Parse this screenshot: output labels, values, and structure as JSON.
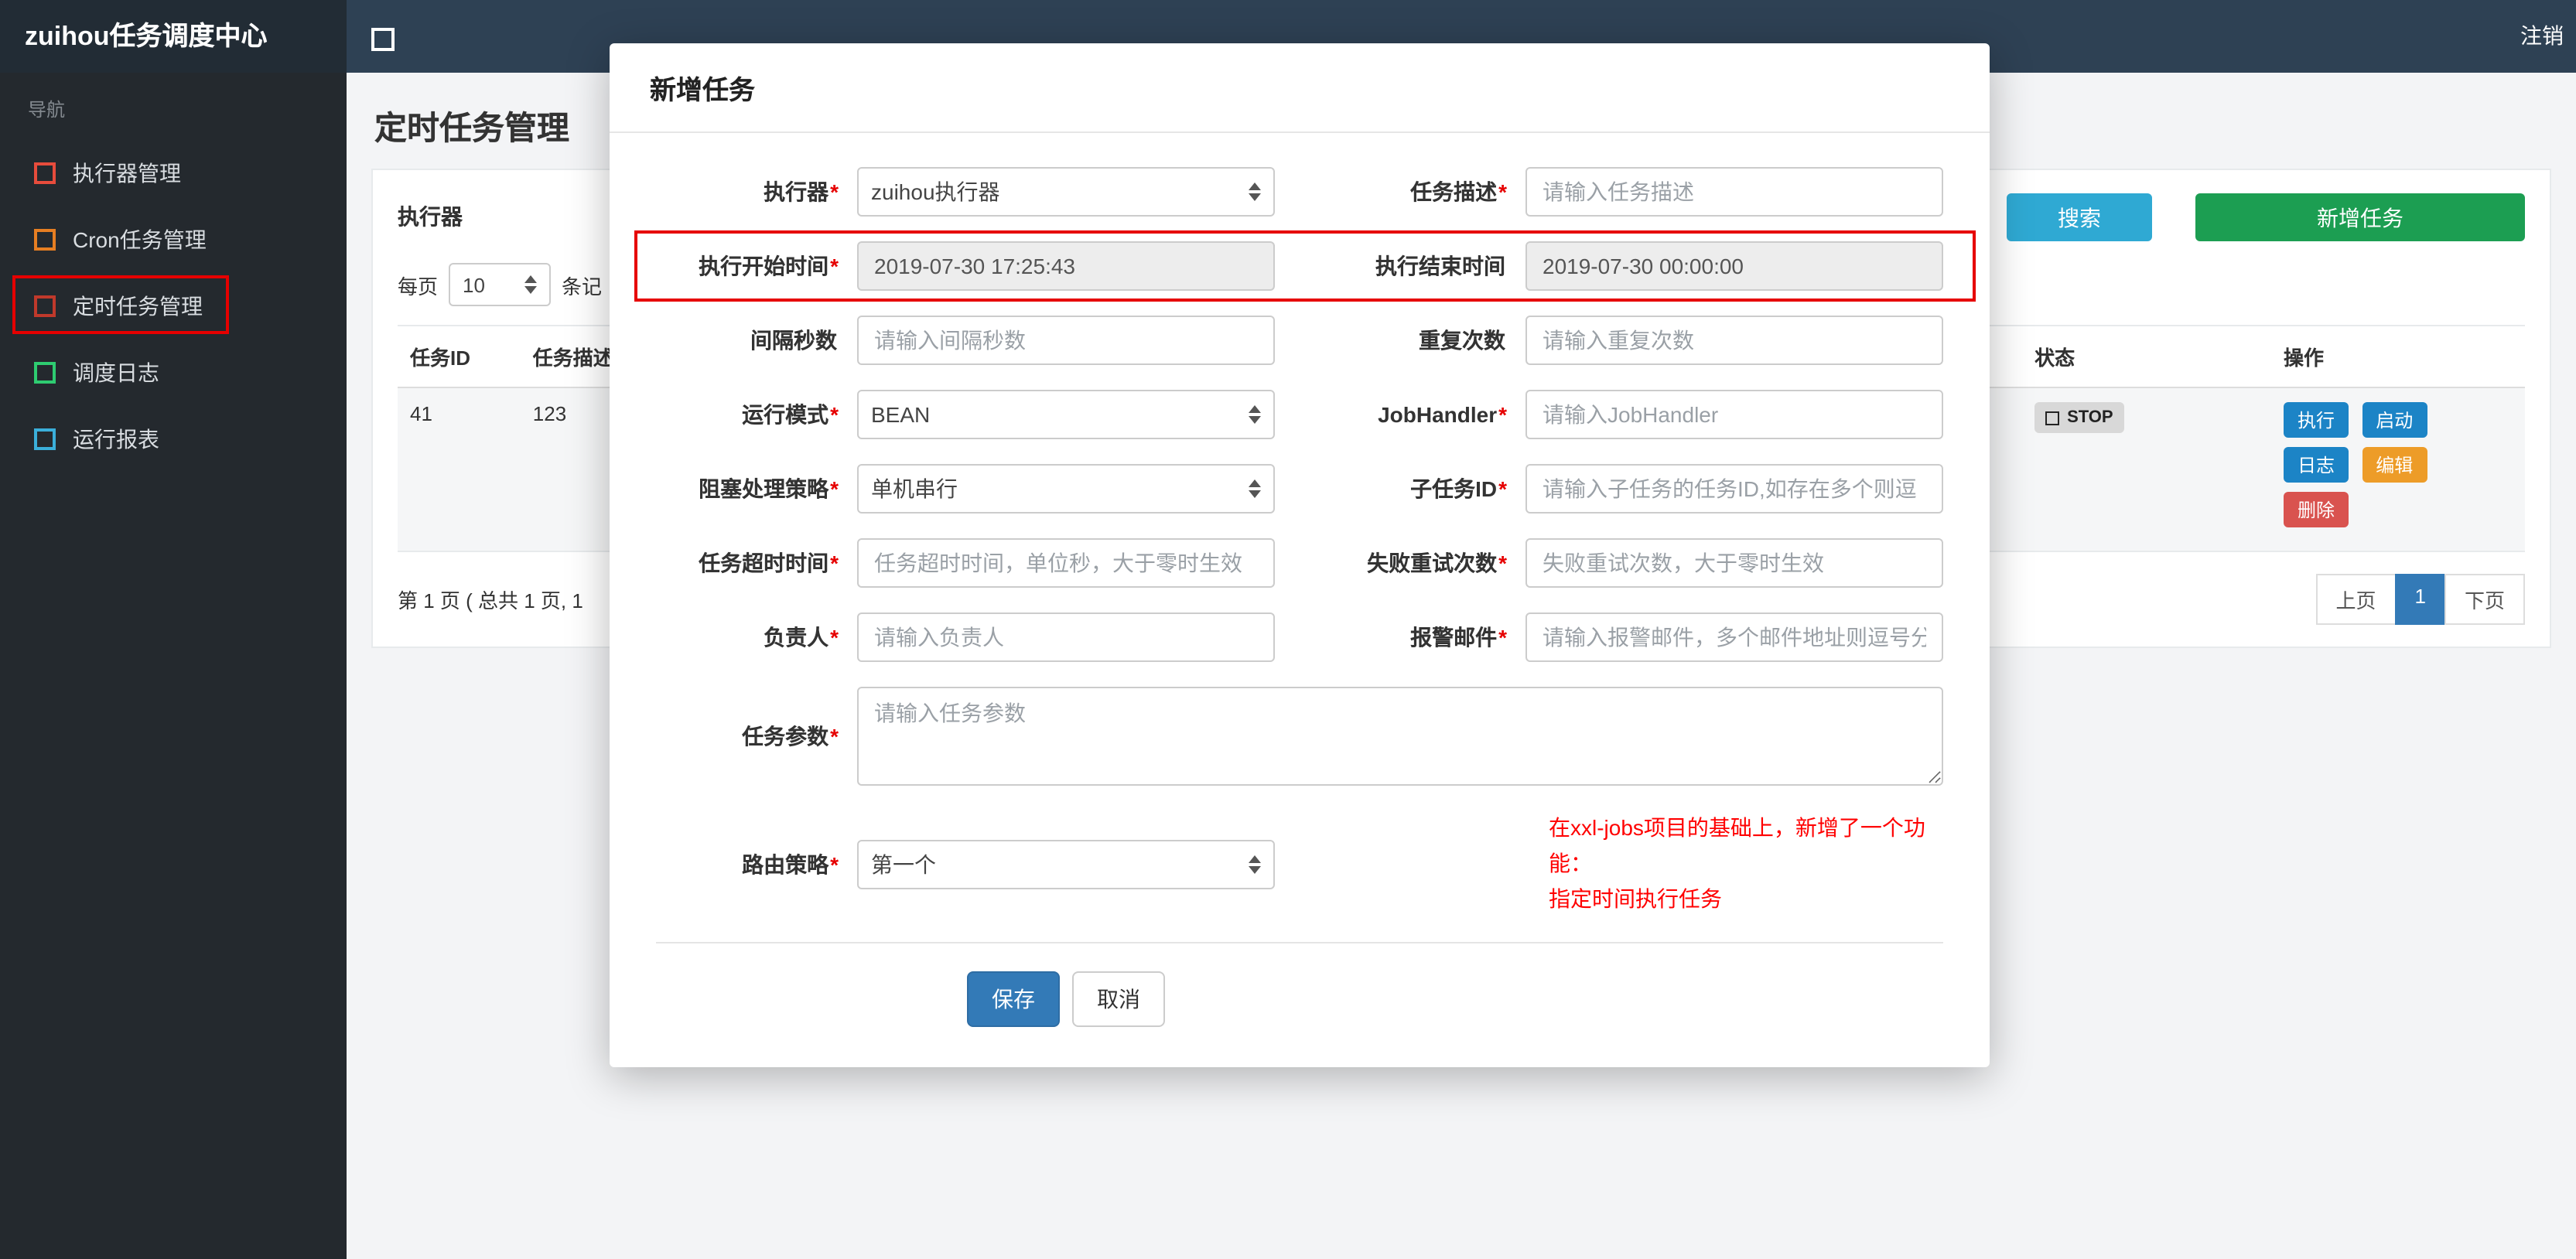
{
  "colors": {
    "search_button": "#2fa9d3",
    "add_button": "#1c9e52",
    "save_button": "#337ab7",
    "page_active": "#337ab7",
    "action_run": "#1c84c6",
    "action_start": "#1c84c6",
    "action_log": "#1c84c6",
    "action_edit": "#ed9c28",
    "action_delete": "#d9534f",
    "annotation": "#e60000",
    "note_text": "#ff0000"
  },
  "navbar": {
    "brand": "zuihou任务调度中心",
    "collapse_icon": "square-outline-icon",
    "logout": "注销"
  },
  "sidebar": {
    "section_label": "导航",
    "items": [
      {
        "label": "执行器管理",
        "icon": "square-outline-icon",
        "icon_color": "#e74c3c"
      },
      {
        "label": "Cron任务管理",
        "icon": "square-outline-icon",
        "icon_color": "#e67e22"
      },
      {
        "label": "定时任务管理",
        "icon": "square-outline-icon",
        "icon_color": "#c0392b",
        "annotated": true
      },
      {
        "label": "调度日志",
        "icon": "square-outline-icon",
        "icon_color": "#2ecc71"
      },
      {
        "label": "运行报表",
        "icon": "square-outline-icon",
        "icon_color": "#3bafda"
      }
    ]
  },
  "main": {
    "page_title": "定时任务管理",
    "toolbar": {
      "executor_label": "执行器",
      "search_button": "搜索",
      "add_button": "新增任务"
    },
    "perpage": {
      "prefix": "每页",
      "value": "10",
      "suffix": "条记"
    },
    "table": {
      "headers": [
        "任务ID",
        "任务描述",
        "状态",
        "操作"
      ],
      "row": {
        "id": "41",
        "desc": "123",
        "status": "STOP",
        "status_icon": "square-outline-icon",
        "actions": [
          "执行",
          "启动",
          "日志",
          "编辑",
          "删除"
        ]
      }
    },
    "footer": {
      "summary": "第 1 页 ( 总共 1 页, 1",
      "prev": "上页",
      "page": "1",
      "next": "下页"
    }
  },
  "modal": {
    "title": "新增任务",
    "rows": [
      {
        "left": {
          "label": "执行器",
          "req": "*",
          "value": "zuihou执行器"
        },
        "right": {
          "label": "任务描述",
          "req": "*",
          "placeholder": "请输入任务描述"
        }
      },
      {
        "left": {
          "label": "执行开始时间",
          "req": "*",
          "value": "2019-07-30 17:25:43"
        },
        "right": {
          "label": "执行结束时间",
          "value": "2019-07-30 00:00:00"
        }
      },
      {
        "left": {
          "label": "间隔秒数",
          "placeholder": "请输入间隔秒数"
        },
        "right": {
          "label": "重复次数",
          "placeholder": "请输入重复次数"
        }
      },
      {
        "left": {
          "label": "运行模式",
          "req": "*",
          "value": "BEAN"
        },
        "right": {
          "label": "JobHandler",
          "req": "*",
          "placeholder": "请输入JobHandler"
        }
      },
      {
        "left": {
          "label": "阻塞处理策略",
          "req": "*",
          "value": "单机串行"
        },
        "right": {
          "label": "子任务ID",
          "req": "*",
          "placeholder": "请输入子任务的任务ID,如存在多个则逗"
        }
      },
      {
        "left": {
          "label": "任务超时时间",
          "req": "*",
          "placeholder": "任务超时时间，单位秒，大于零时生效"
        },
        "right": {
          "label": "失败重试次数",
          "req": "*",
          "placeholder": "失败重试次数，大于零时生效"
        }
      },
      {
        "left": {
          "label": "负责人",
          "req": "*",
          "placeholder": "请输入负责人"
        },
        "right": {
          "label": "报警邮件",
          "req": "*",
          "placeholder": "请输入报警邮件，多个邮件地址则逗号分"
        }
      },
      {
        "field": {
          "label": "任务参数",
          "req": "*",
          "placeholder": "请输入任务参数"
        }
      },
      {
        "left": {
          "label": "路由策略",
          "req": "*",
          "value": "第一个"
        },
        "note": [
          "在xxl-jobs项目的基础上，新增了一个功能：",
          "指定时间执行任务"
        ]
      }
    ],
    "save": "保存",
    "cancel": "取消"
  }
}
